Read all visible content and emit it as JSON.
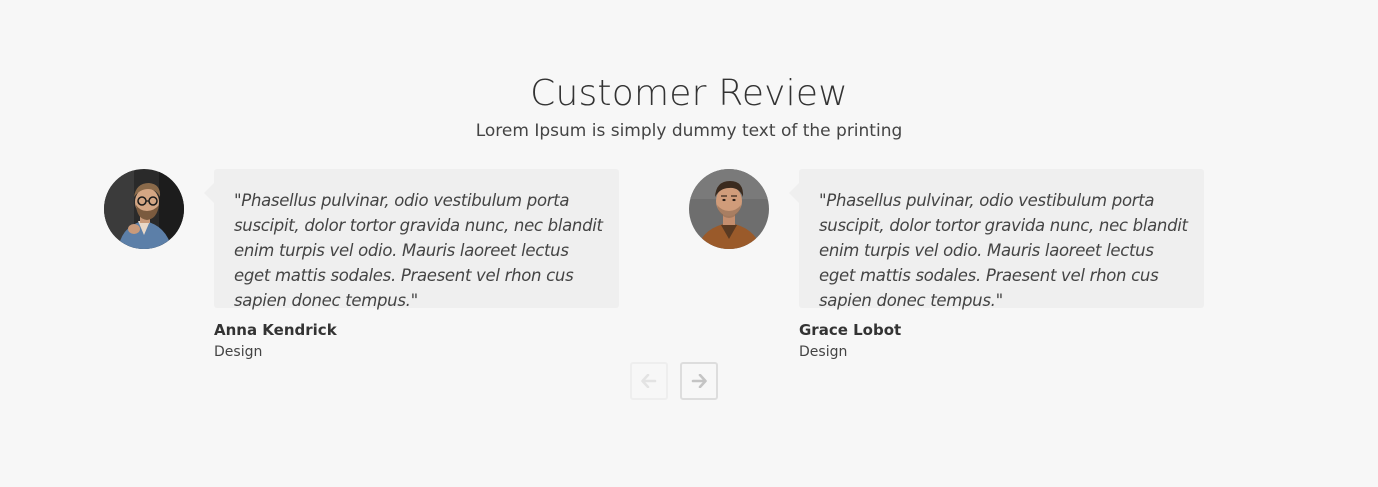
{
  "section": {
    "title": "Customer Review",
    "subtitle": "Lorem Ipsum is simply dummy text of the printing"
  },
  "reviews": [
    {
      "quote": "\"Phasellus pulvinar, odio vestibulum porta suscipit, dolor tortor gravida nunc, nec blandit enim turpis vel odio. Mauris laoreet lectus eget mattis sodales. Praesent vel rhon cus sapien donec tempus.\"",
      "name": "Anna Kendrick",
      "role": "Design",
      "avatar_icon": "man-with-glasses-photo"
    },
    {
      "quote": "\"Phasellus pulvinar, odio vestibulum porta suscipit, dolor tortor gravida nunc, nec blandit enim turpis vel odio. Mauris laoreet lectus eget mattis sodales. Praesent vel rhon cus sapien donec tempus.\"",
      "name": "Grace Lobot",
      "role": "Design",
      "avatar_icon": "man-brown-jacket-photo"
    }
  ],
  "navigation": {
    "prev_icon": "arrow-left-icon",
    "next_icon": "arrow-right-icon",
    "prev_color": "#e3e3e3",
    "next_color": "#c4c4c4"
  },
  "colors": {
    "background": "#f7f7f7",
    "bubble": "#efefef",
    "text": "#333333"
  }
}
